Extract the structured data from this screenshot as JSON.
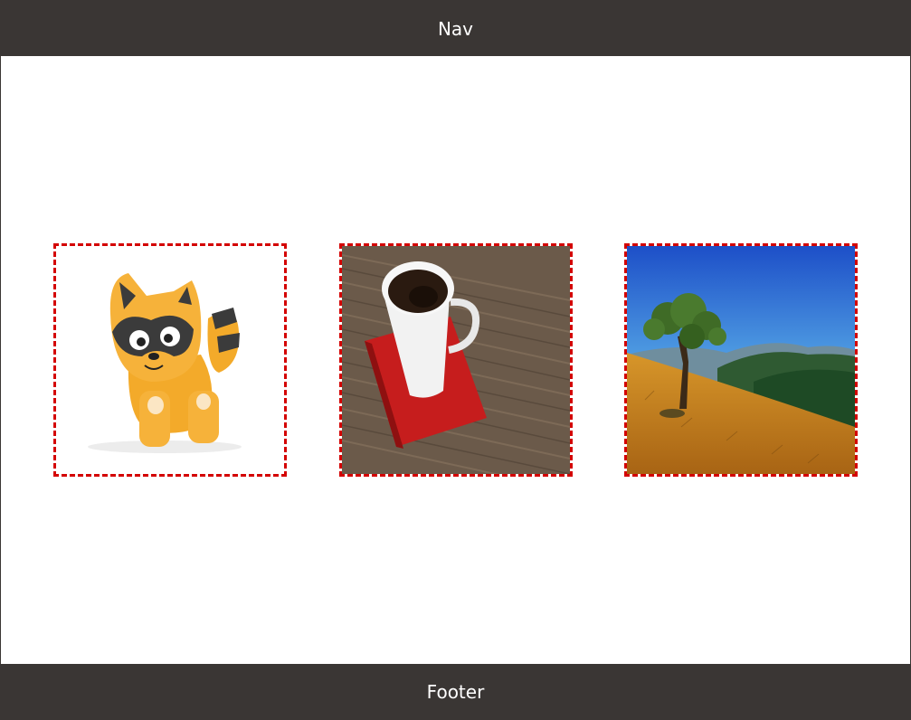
{
  "nav": {
    "label": "Nav"
  },
  "footer": {
    "label": "Footer"
  },
  "gallery": {
    "items": [
      {
        "icon": "raccoon-toy-image"
      },
      {
        "icon": "coffee-cup-image"
      },
      {
        "icon": "hillside-tree-image"
      }
    ]
  },
  "colors": {
    "bar": "#3a3634",
    "border": "#d40000",
    "text": "#ffffff",
    "background": "#ffffff"
  }
}
